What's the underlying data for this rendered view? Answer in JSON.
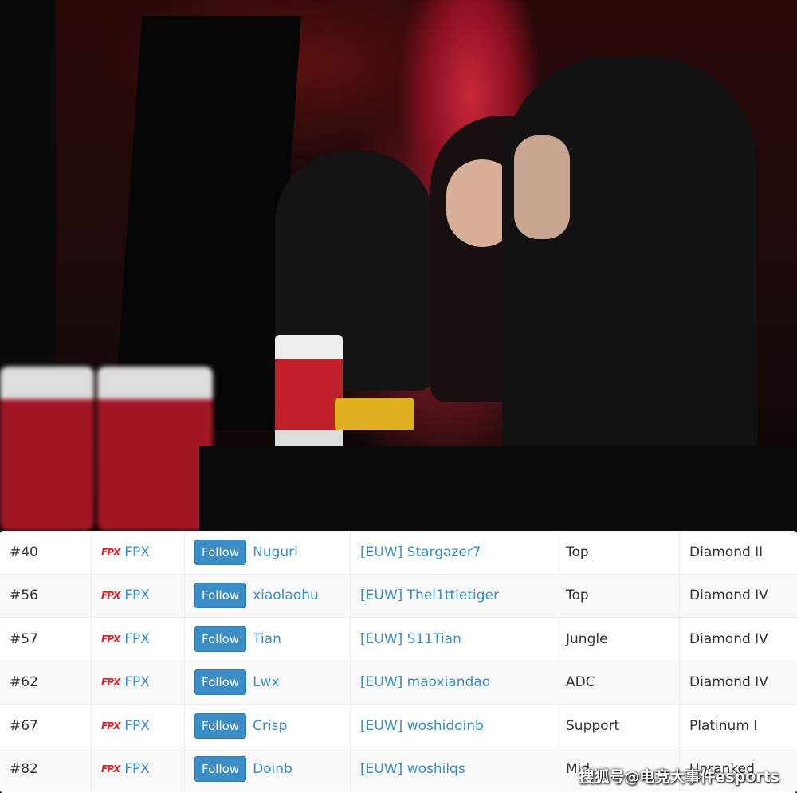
{
  "photo": {
    "icon": "esports-players-photo"
  },
  "table": {
    "rows": [
      {
        "rank": "#40",
        "team": "FPX",
        "player": "Nuguri",
        "account": "[EUW] Stargazer7",
        "role": "Top",
        "tier": "Diamond II"
      },
      {
        "rank": "#56",
        "team": "FPX",
        "player": "xiaolaohu",
        "account": "[EUW] Thel1ttletiger",
        "role": "Top",
        "tier": "Diamond IV"
      },
      {
        "rank": "#57",
        "team": "FPX",
        "player": "Tian",
        "account": "[EUW] S11Tian",
        "role": "Jungle",
        "tier": "Diamond IV"
      },
      {
        "rank": "#62",
        "team": "FPX",
        "player": "Lwx",
        "account": "[EUW] maoxiandao",
        "role": "ADC",
        "tier": "Diamond IV"
      },
      {
        "rank": "#67",
        "team": "FPX",
        "player": "Crisp",
        "account": "[EUW] woshidoinb",
        "role": "Support",
        "tier": "Platinum I"
      },
      {
        "rank": "#82",
        "team": "FPX",
        "player": "Doinb",
        "account": "[EUW] woshilqs",
        "role": "Mid",
        "tier": "Unranked"
      }
    ],
    "follow_label": "Follow",
    "logo_text": "FPX"
  },
  "watermark": "搜狐号@电竞大事件esports",
  "colors": {
    "link": "#3a8ec5",
    "button": "#3a8ec5",
    "logo": "#e8202a"
  }
}
